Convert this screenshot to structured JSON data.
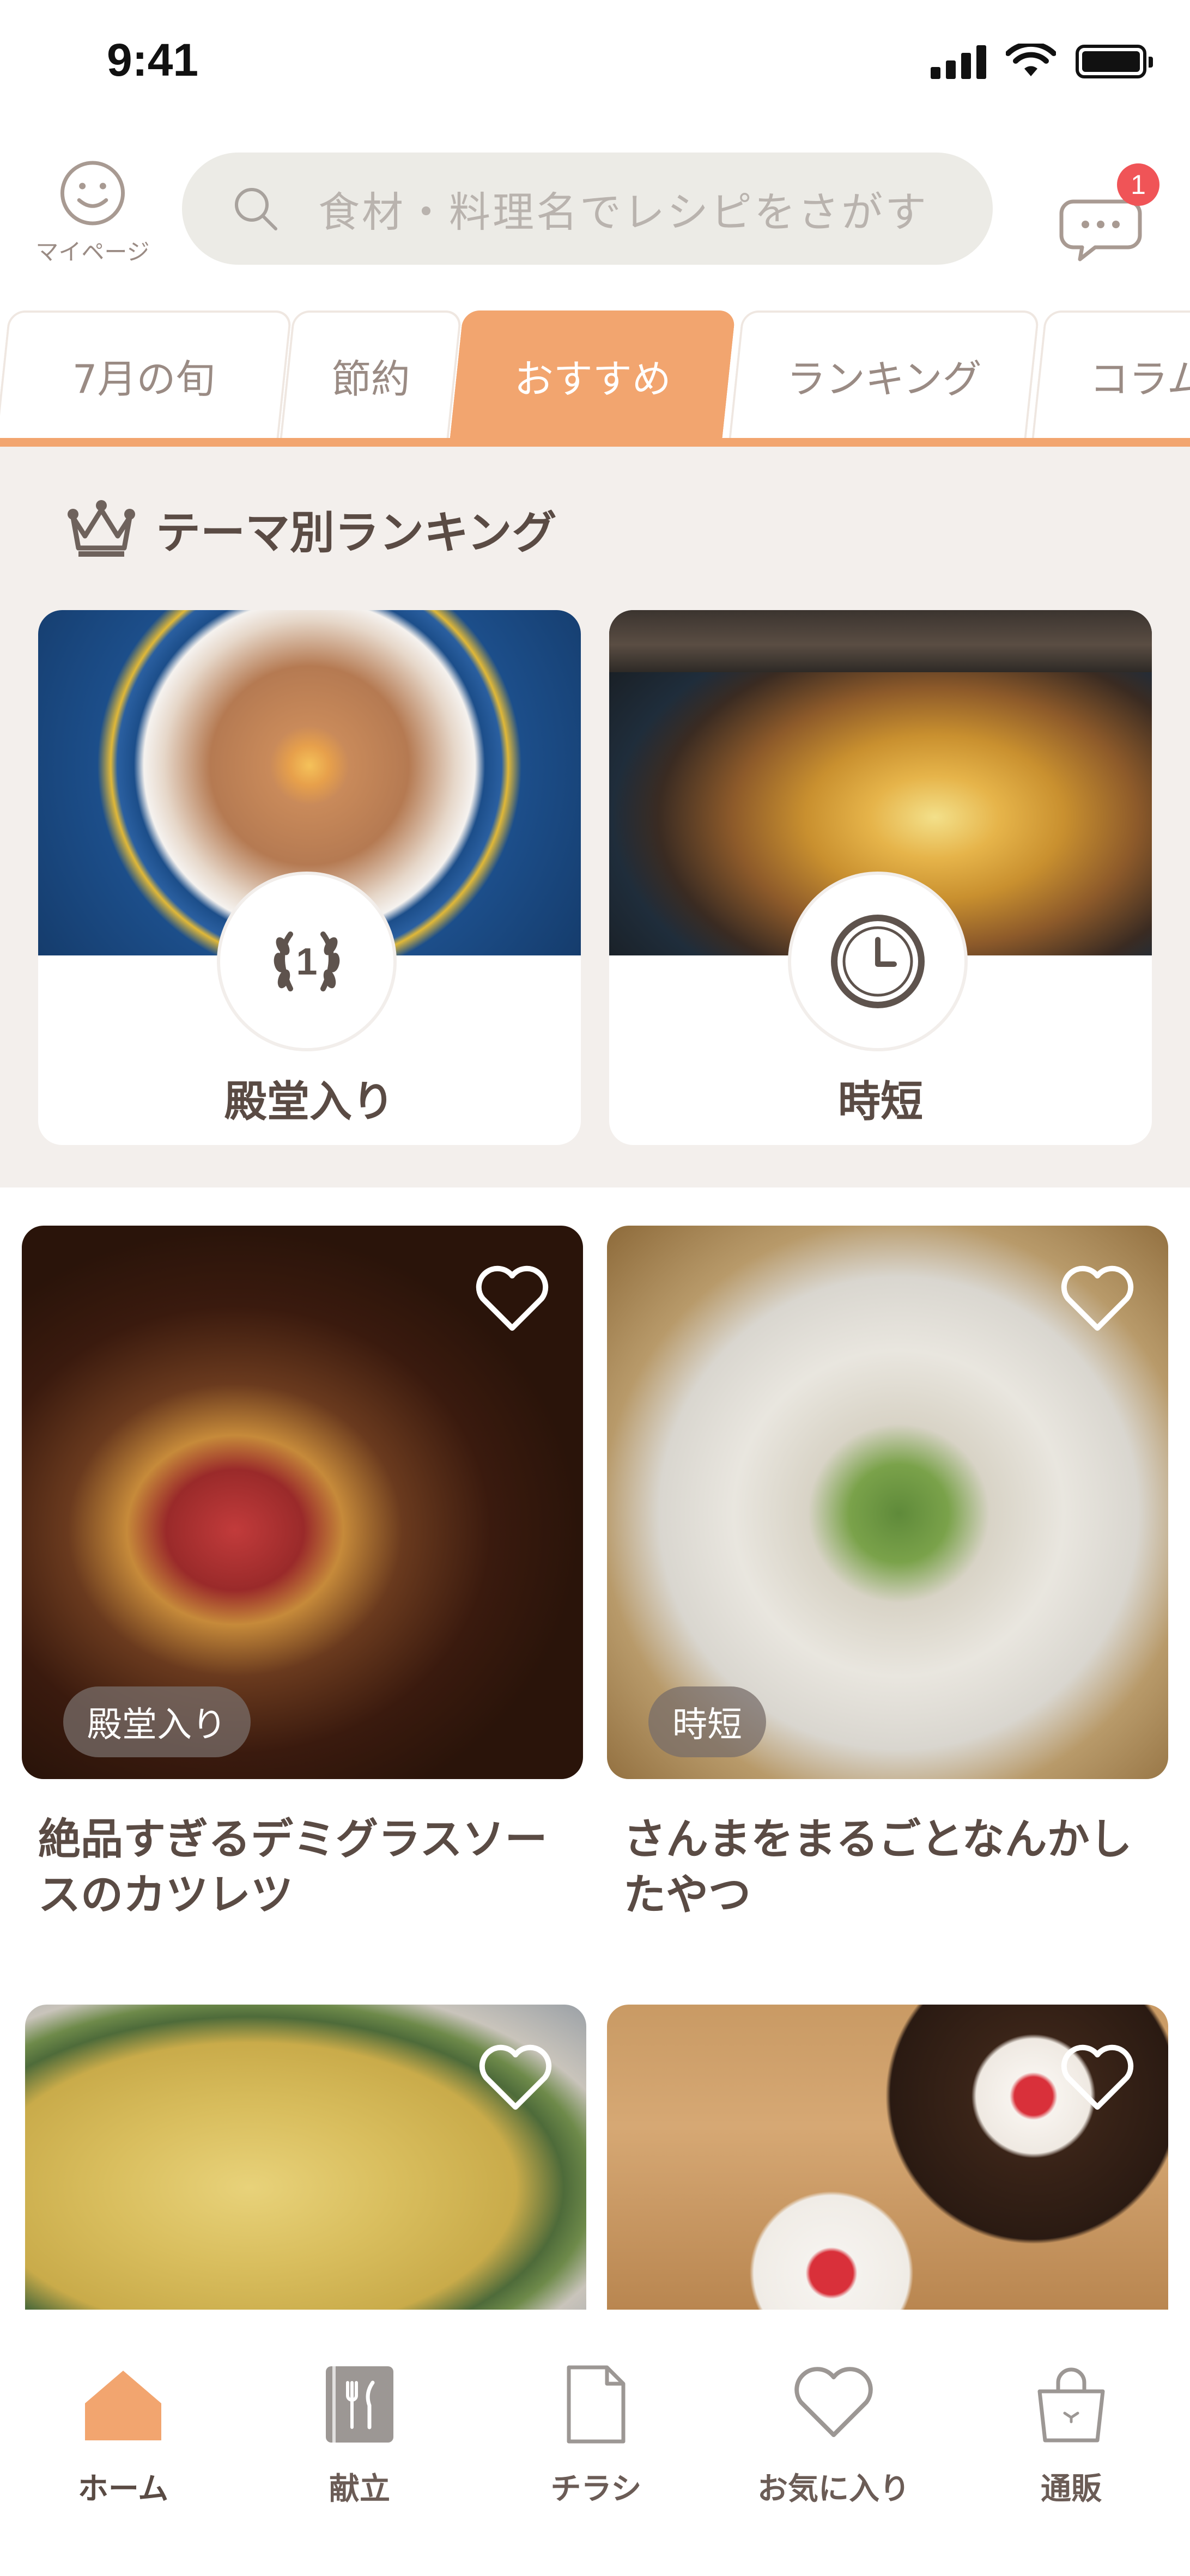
{
  "status_bar": {
    "time": "9:41"
  },
  "header": {
    "mypage_label": "マイページ",
    "search_placeholder": "食材・料理名でレシピをさがす",
    "notification_count": "1"
  },
  "tabs": [
    {
      "label": "7月の旬",
      "active": false
    },
    {
      "label": "節約",
      "active": false
    },
    {
      "label": "おすすめ",
      "active": true
    },
    {
      "label": "ランキング",
      "active": false
    },
    {
      "label": "コラム",
      "active": false
    }
  ],
  "ranking": {
    "title": "テーマ別ランキング",
    "themes": [
      {
        "label": "殿堂入り",
        "badge_number": "1",
        "icon": "laurel-medal-icon"
      },
      {
        "label": "時短",
        "icon": "clock-icon"
      }
    ]
  },
  "recipes": [
    {
      "title": "絶品すぎるデミグラスソースのカツレツ",
      "tag": "殿堂入り"
    },
    {
      "title": "さんまをまるごとなんかしたやつ",
      "tag": "時短"
    },
    {
      "title": "",
      "tag": ""
    },
    {
      "title": "",
      "tag": ""
    }
  ],
  "bottom_nav": [
    {
      "label": "ホーム",
      "icon": "home-icon",
      "active": true
    },
    {
      "label": "献立",
      "icon": "menu-book-icon",
      "active": false
    },
    {
      "label": "チラシ",
      "icon": "flyer-icon",
      "active": false
    },
    {
      "label": "お気に入り",
      "icon": "heart-icon",
      "active": false
    },
    {
      "label": "通販",
      "icon": "shopping-bag-icon",
      "active": false
    }
  ],
  "colors": {
    "accent": "#f2a56f",
    "section_bg": "#f3efec",
    "badge": "#f05457",
    "text": "#5a4b44"
  }
}
